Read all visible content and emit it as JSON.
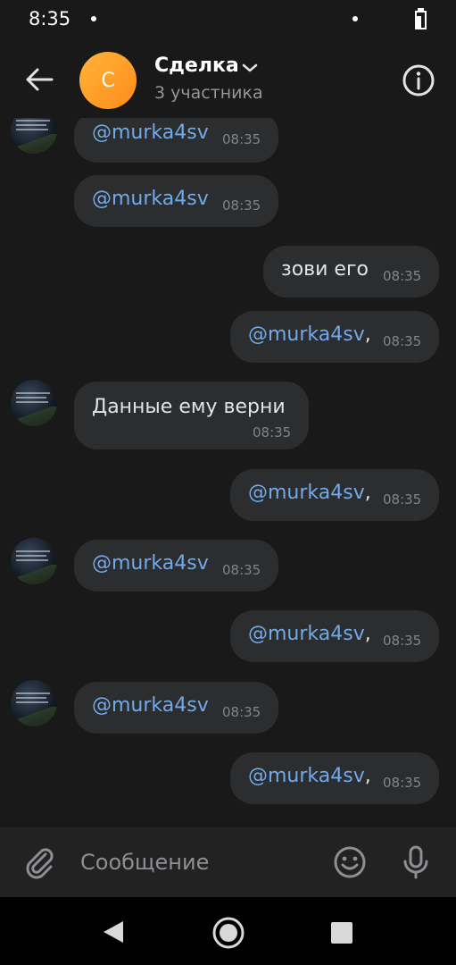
{
  "status_bar": {
    "time": "8:35"
  },
  "header": {
    "avatar_letter": "С",
    "title": "Сделка",
    "subtitle": "3 участника"
  },
  "messages": [
    {
      "side": "in",
      "text": "@murka4sv",
      "time": "08:35",
      "mention": true
    },
    {
      "side": "in",
      "text": "@murka4sv",
      "time": "08:35",
      "mention": true
    },
    {
      "side": "out",
      "text": "зови его",
      "time": "08:35",
      "mention": false
    },
    {
      "side": "out",
      "text": "@murka4sv",
      "suffix": ",",
      "time": "08:35",
      "mention": true
    },
    {
      "side": "in",
      "text": "Данные ему верни",
      "time": "08:35",
      "mention": false
    },
    {
      "side": "out",
      "text": "@murka4sv",
      "suffix": ",",
      "time": "08:35",
      "mention": true
    },
    {
      "side": "in",
      "text": "@murka4sv",
      "time": "08:35",
      "mention": true
    },
    {
      "side": "out",
      "text": "@murka4sv",
      "suffix": ",",
      "time": "08:35",
      "mention": true
    },
    {
      "side": "in",
      "text": "@murka4sv",
      "time": "08:35",
      "mention": true
    },
    {
      "side": "out",
      "text": "@murka4sv",
      "suffix": ",",
      "time": "08:35",
      "mention": true
    }
  ],
  "composer": {
    "placeholder": "Сообщение"
  },
  "colors": {
    "background": "#19191a",
    "bubble": "#2c2d2e",
    "mention": "#71aaeb",
    "avatar_orange": "#ff9e2a"
  },
  "icons": {
    "back": "arrow-left-icon",
    "info": "info-icon",
    "attach": "paperclip-icon",
    "emoji": "smile-icon",
    "mic": "microphone-icon"
  }
}
